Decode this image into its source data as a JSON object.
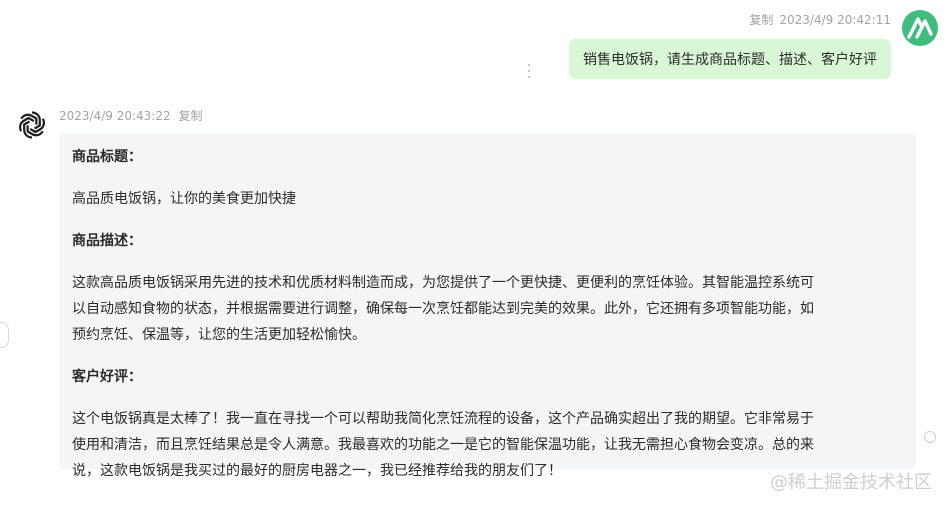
{
  "user_message": {
    "copy_label": "复制",
    "timestamp": "2023/4/9 20:42:11",
    "text": "销售电饭锅，请生成商品标题、描述、客户好评"
  },
  "assistant_message": {
    "timestamp": "2023/4/9 20:43:22",
    "copy_label": "复制",
    "title_heading": "商品标题：",
    "title_text": "高品质电饭锅，让你的美食更加快捷",
    "description_heading": "商品描述：",
    "description_lines": [
      "这款高品质电饭锅采用先进的技术和优质材料制造而成，为您提供了一个更快捷、更便利的烹饪体验。其智能温控系统可",
      "以自动感知食物的状态，并根据需要进行调整，确保每一次烹饪都能达到完美的效果。此外，它还拥有多项智能功能，如",
      "预约烹饪、保温等，让您的生活更加轻松愉快。"
    ],
    "review_heading": "客户好评：",
    "review_lines": [
      "这个电饭锅真是太棒了！我一直在寻找一个可以帮助我简化烹饪流程的设备，这个产品确实超出了我的期望。它非常易于",
      "使用和清洁，而且烹饪结果总是令人满意。我最喜欢的功能之一是它的智能保温功能，让我无需担心食物会变凉。总的来",
      "说，这款电饭锅是我买过的最好的厨房电器之一，我已经推荐给我的朋友们了！"
    ]
  },
  "watermark": "@稀土掘金技术社区",
  "colors": {
    "user_bubble": "#d8f7d5",
    "user_avatar": "#3ebd7c",
    "assistant_bubble": "#f4f5f7",
    "meta_text": "#a3a3a3"
  },
  "icons": {
    "user_avatar": "app-logo-icon",
    "assistant_avatar": "openai-logo-icon",
    "more": "more-vertical-icon"
  }
}
